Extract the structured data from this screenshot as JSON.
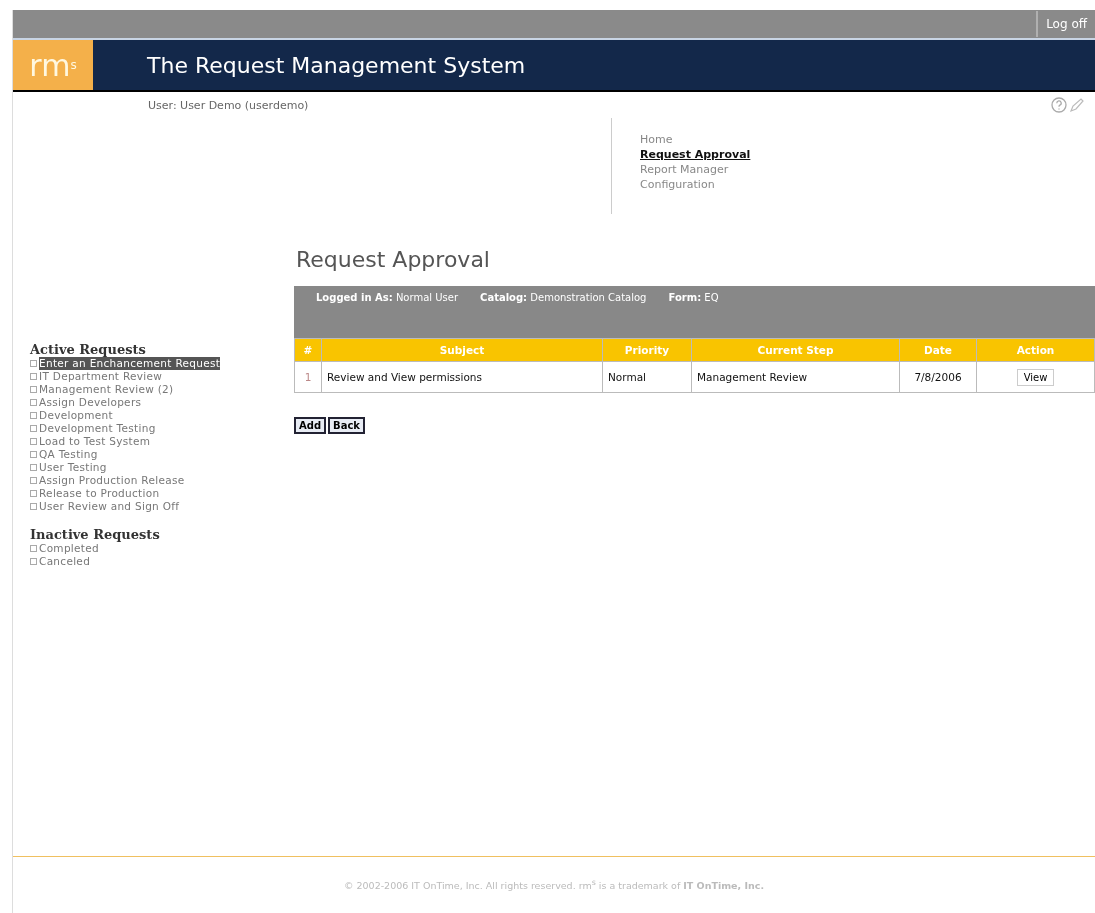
{
  "top_bar": {
    "logoff": "Log off"
  },
  "banner": {
    "logo": "rm$^{s}$",
    "title": "The Request Management System"
  },
  "user_line": "User: User Demo (userdemo)",
  "nav": [
    {
      "label": "Home",
      "selected": false
    },
    {
      "label": "Request Approval",
      "selected": true
    },
    {
      "label": "Report Manager",
      "selected": false
    },
    {
      "label": "Configuration",
      "selected": false
    }
  ],
  "sidebar": {
    "sections": [
      {
        "title": "Active Requests",
        "items": [
          {
            "label": "Enter an Enchancement Request",
            "selected": true
          },
          {
            "label": "IT Department Review",
            "selected": false
          },
          {
            "label": "Management Review (2)",
            "selected": false
          },
          {
            "label": "Assign Developers",
            "selected": false
          },
          {
            "label": "Development",
            "selected": false
          },
          {
            "label": "Development Testing",
            "selected": false
          },
          {
            "label": "Load to Test System",
            "selected": false
          },
          {
            "label": "QA Testing",
            "selected": false
          },
          {
            "label": "User Testing",
            "selected": false
          },
          {
            "label": "Assign Production Release",
            "selected": false
          },
          {
            "label": "Release to Production",
            "selected": false
          },
          {
            "label": "User Review and Sign Off",
            "selected": false
          }
        ]
      },
      {
        "title": "Inactive Requests",
        "items": [
          {
            "label": "Completed",
            "selected": false
          },
          {
            "label": "Canceled",
            "selected": false
          }
        ]
      }
    ]
  },
  "page_title": "Request Approval",
  "info": [
    {
      "label": "Logged in As:",
      "value": "Normal User"
    },
    {
      "label": "Catalog:",
      "value": "Demonstration Catalog"
    },
    {
      "label": "Form:",
      "value": "EQ"
    }
  ],
  "table": {
    "columns": [
      "#",
      "Subject",
      "Priority",
      "Current Step",
      "Date",
      "Action"
    ],
    "rows": [
      {
        "number": "1",
        "subject": "Review and View permissions",
        "priority": "Normal",
        "current_step": "Management Review",
        "date": "7/8/2006",
        "action": "View"
      }
    ]
  },
  "buttons": [
    "Add",
    "Back"
  ],
  "footer": "© 2002-2006 IT OnTime, Inc. All rights reserved. rm$^{s}$ is a trademark of **IT OnTime, Inc.**"
}
